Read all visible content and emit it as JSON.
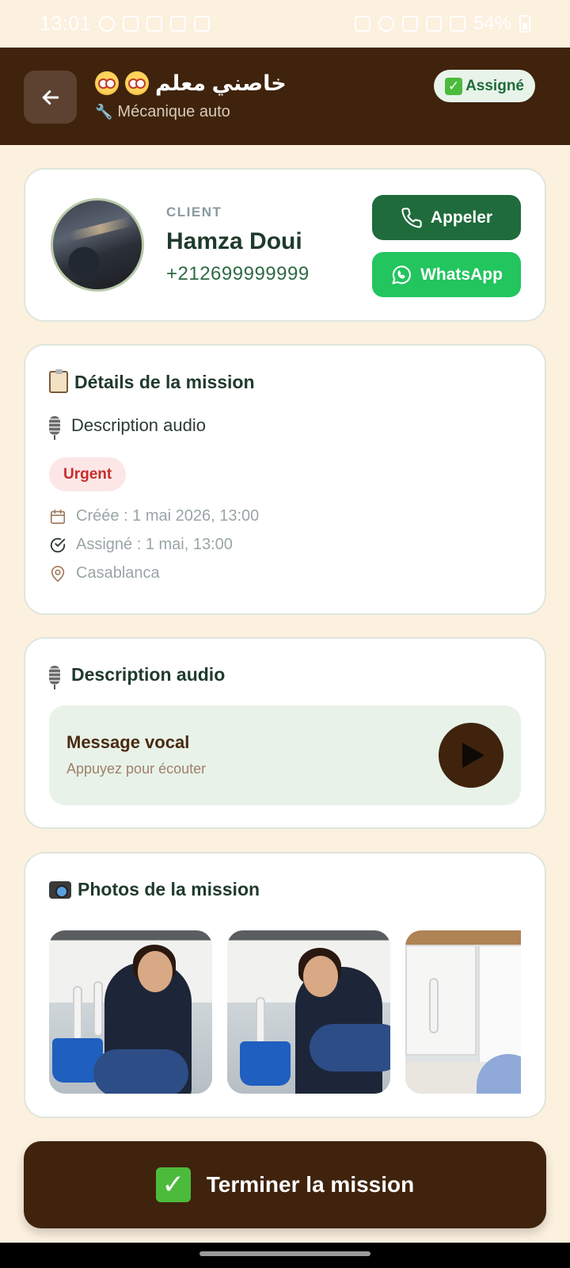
{
  "status_bar": {
    "time": "13:01",
    "battery": "54%"
  },
  "header": {
    "title": "خاصني معلم",
    "subtitle": "Mécanique auto",
    "status_badge": "Assigné",
    "back_icon": "arrow-left-icon",
    "title_emoji": "astonished-face-emoji"
  },
  "client": {
    "label": "CLIENT",
    "name": "Hamza Doui",
    "phone": "+212699999999",
    "call_label": "Appeler",
    "whatsapp_label": "WhatsApp"
  },
  "details": {
    "title": "Détails de la mission",
    "description": "Description audio",
    "priority": "Urgent",
    "created": "Créée : 1 mai 2026, 13:00",
    "assigned": "Assigné : 1 mai, 13:00",
    "location": "Casablanca"
  },
  "audio": {
    "title": "Description audio",
    "voice_title": "Message vocal",
    "voice_hint": "Appuyez pour écouter"
  },
  "photos": {
    "title": "Photos de la mission"
  },
  "footer": {
    "finish_label": "Terminer la mission"
  },
  "colors": {
    "brand_dark": "#3f230c",
    "background": "#fcf0df",
    "primary_green": "#1f6b3b",
    "whatsapp_green": "#22c55e",
    "urgent_red": "#c62d2d"
  }
}
